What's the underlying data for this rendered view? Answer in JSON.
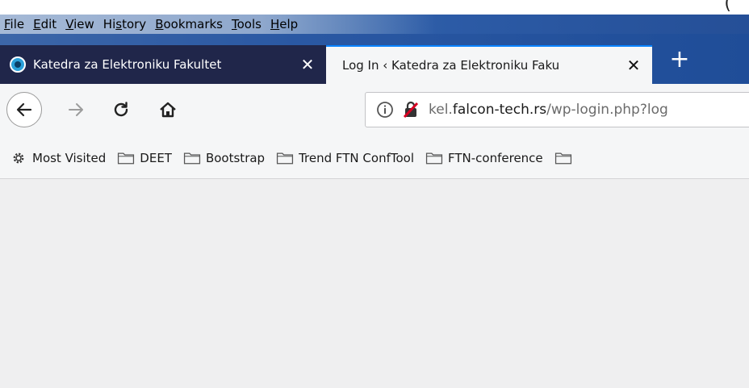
{
  "menubar": {
    "items": [
      {
        "label": "File",
        "accel": "F",
        "rest": "ile"
      },
      {
        "label": "Edit",
        "accel": "E",
        "rest": "dit"
      },
      {
        "label": "View",
        "accel": "V",
        "rest": "iew"
      },
      {
        "label": "History",
        "pre": "Hi",
        "accel": "s",
        "rest": "tory"
      },
      {
        "label": "Bookmarks",
        "accel": "B",
        "rest": "ookmarks"
      },
      {
        "label": "Tools",
        "accel": "T",
        "rest": "ools"
      },
      {
        "label": "Help",
        "accel": "H",
        "rest": "elp"
      }
    ],
    "corner_glyph": "("
  },
  "tabs": [
    {
      "title": "Katedra za Elektroniku Fakultet",
      "close": "✕",
      "active": false
    },
    {
      "title": "Log In ‹ Katedra za Elektroniku Faku",
      "close": "✕",
      "active": true
    }
  ],
  "new_tab_label": "+",
  "navbar": {
    "url_subdomain": "kel.",
    "url_host": "falcon-tech.rs",
    "url_path": "/wp-login.php?log"
  },
  "bookmarks": [
    {
      "label": "Most Visited",
      "icon": "gear-icon"
    },
    {
      "label": "DEET",
      "icon": "folder-icon"
    },
    {
      "label": "Bootstrap",
      "icon": "folder-icon"
    },
    {
      "label": "Trend FTN ConfTool",
      "icon": "folder-icon"
    },
    {
      "label": "FTN-conference",
      "icon": "folder-icon"
    }
  ],
  "colors": {
    "accent": "#0a84ff",
    "inactive_tab": "#20264a",
    "toolbar": "#f5f6f7",
    "content": "#efeff0"
  }
}
